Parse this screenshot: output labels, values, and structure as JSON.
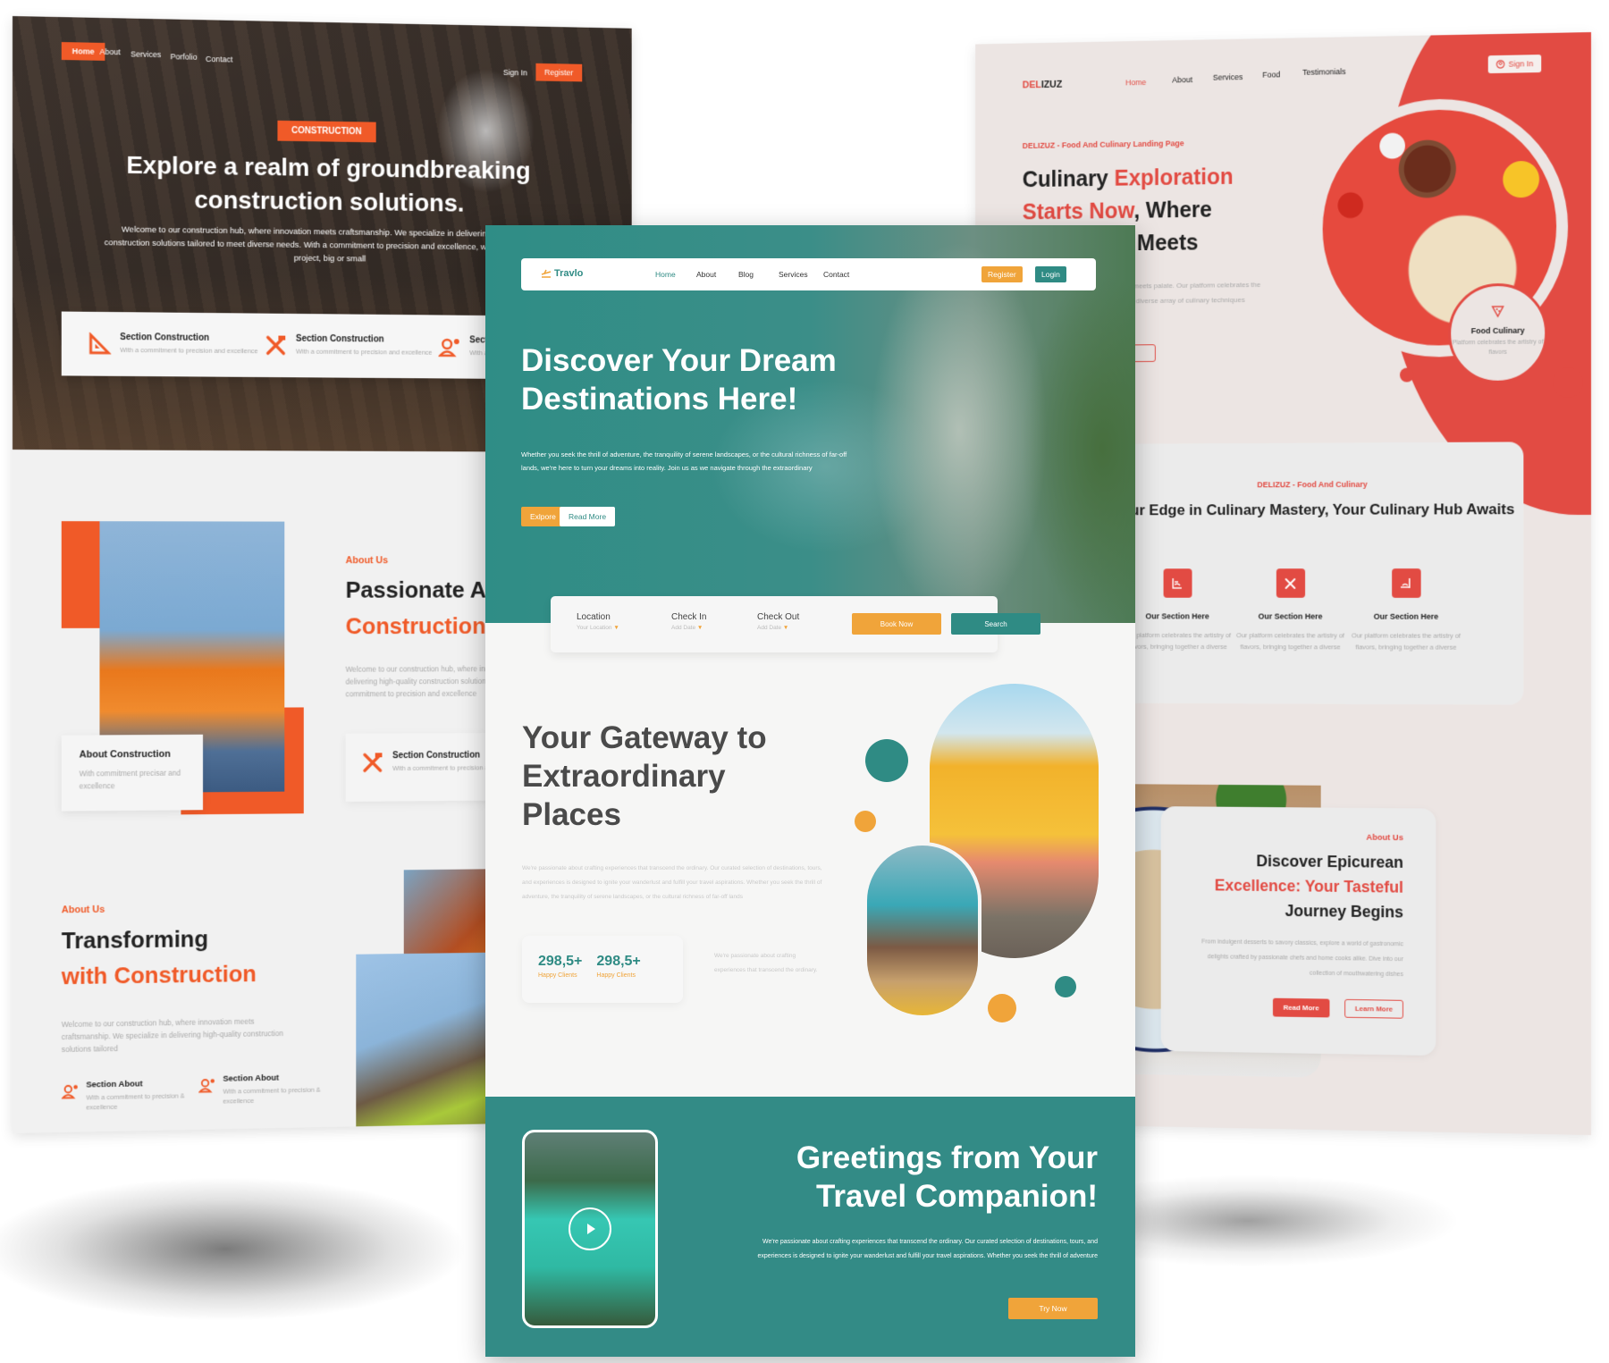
{
  "colors": {
    "construction_accent": "#f05a28",
    "delizuz_accent": "#e24b43",
    "travlo_teal": "#2f8b84",
    "travlo_orange": "#f0a43a"
  },
  "construction": {
    "nav": {
      "home": "Home",
      "about": "About",
      "services": "Services",
      "portfolio": "Porfolio",
      "contact": "Contact",
      "sign_in": "Sign In",
      "register": "Register"
    },
    "hero": {
      "badge": "CONSTRUCTION",
      "title": "Explore a realm of groundbreaking construction solutions.",
      "description": "Welcome to our construction hub, where innovation meets craftsmanship. We specialize in delivering high-quality construction solutions tailored to meet diverse needs. With a commitment to precision and excellence, we embark on each project, big or small"
    },
    "features": [
      {
        "icon": "set-square-icon",
        "title": "Section Construction",
        "desc": "With a commitment to precision and excellence"
      },
      {
        "icon": "tools-icon",
        "title": "Section Construction",
        "desc": "With a commitment to precision and excellence"
      },
      {
        "icon": "worker-gear-icon",
        "title": "Section Construction",
        "desc": "With a commitment to precision and excellence"
      }
    ],
    "about_card": {
      "title": "About Construction",
      "desc": "With commitment precisar and excellence"
    },
    "about1": {
      "label": "About Us",
      "heading_line1": "Passionate About",
      "heading_line2": "Construction",
      "text": "Welcome to our construction hub, where innovation meets craftsmanship. We specialize in delivering high-quality construction solutions tailored to meet diverse needs. With a commitment to precision and excellence",
      "card_title": "Section Construction",
      "card_desc": "With a commitment to precision and excellence"
    },
    "about2": {
      "label": "About Us",
      "heading_line1": "Transforming",
      "heading_line2": "with Construction",
      "text": "Welcome to our construction hub, where innovation meets craftsmanship. We specialize in delivering high-quality construction solutions tailored",
      "items": [
        {
          "title": "Section About",
          "desc": "With a commitment to precision & excellence"
        },
        {
          "title": "Section About",
          "desc": "With a commitment to precision & excellence"
        }
      ]
    }
  },
  "delizuz": {
    "logo_red": "DEL",
    "logo_dark": "IZUZ",
    "nav": {
      "home": "Home",
      "about": "About",
      "services": "Services",
      "food": "Food",
      "testimonials": "Testimonials",
      "sign_in": "Sign In"
    },
    "hero": {
      "tag": "DELIZUZ - Food And Culinary Landing Page",
      "h_part1": "Culinary ",
      "h_part2": "Exploration Starts Now",
      "h_part3": ", Where Innovation Meets Tradition",
      "text": "Welcome to Delizuz, where passion meets palate. Our platform celebrates the artistry of flavors, bringing together a diverse array of culinary techniques",
      "badge_title": "Food Culinary",
      "badge_desc": "Platform celebrates the artistry of flavors"
    },
    "services": {
      "tag": "DELIZUZ - Food And Culinary",
      "heading": "Your Edge in Culinary Mastery, Your Culinary Hub Awaits",
      "items": [
        {
          "icon": "stove-icon",
          "title": "Our Section Here",
          "desc": "Our platform celebrates the artistry of flavors, bringing together a diverse"
        },
        {
          "icon": "cutlery-icon",
          "title": "Our Section Here",
          "desc": "Our platform celebrates the artistry of flavors, bringing together a diverse"
        },
        {
          "icon": "dish-icon",
          "title": "Our Section Here",
          "desc": "Our platform celebrates the artistry of flavors, bringing together a diverse"
        }
      ]
    },
    "about": {
      "label": "About Us",
      "h_line1": "Discover Epicurean",
      "h_line2": "Excellence: Your Tasteful",
      "h_line3": "Journey Begins",
      "text": "From indulgent desserts to savory classics, explore a world of gastronomic delights crafted by passionate chefs and home cooks alike. Dive into our collection of mouthwatering dishes",
      "read_more": "Read More",
      "learn_more": "Learn More"
    }
  },
  "travlo": {
    "logo": "Travlo",
    "nav": {
      "home": "Home",
      "about": "About",
      "blog": "Blog",
      "services": "Services",
      "contact": "Contact",
      "register": "Register",
      "login": "Login"
    },
    "hero": {
      "title_line1": "Discover Your Dream",
      "title_line2": "Destinations Here!",
      "text": "Whether you seek the thrill of adventure, the tranquility of serene landscapes, or the cultural richness of far-off lands, we're here to turn your dreams into reality. Join us as we navigate through the extraordinary",
      "explore": "Exlpore",
      "read_more": "Read More"
    },
    "booking": {
      "location_label": "Location",
      "location_value": "Your Location",
      "checkin_label": "Check In",
      "checkin_value": "Add Date",
      "checkout_label": "Check Out",
      "checkout_value": "Add Date",
      "book_now": "Book Now",
      "search": "Search"
    },
    "gateway": {
      "title_line1": "Your Gateway to",
      "title_line2": "Extraordinary",
      "title_line3": "Places",
      "text": "We're passionate about crafting experiences that transcend the ordinary. Our curated selection of destinations, tours, and experiences is designed to ignite your wanderlust and fulfill your travel aspirations. Whether you seek the thrill of adventure, the tranquility of serene landscapes, or the cultural richness of far-off lands",
      "stats": [
        {
          "number": "298,5+",
          "label": "Happy Clients"
        },
        {
          "number": "298,5+",
          "label": "Happy Clients"
        }
      ],
      "side_text": "We're passionate about crafting experiences that transcend the ordinary."
    },
    "greeting": {
      "title_line1": "Greetings from Your",
      "title_line2": "Travel Companion!",
      "text": "We're passionate about crafting experiences that transcend the ordinary. Our curated selection of destinations, tours, and experiences is designed to ignite your wanderlust and fulfill your travel aspirations. Whether you seek the thrill of adventure",
      "try_now": "Try Now"
    }
  }
}
